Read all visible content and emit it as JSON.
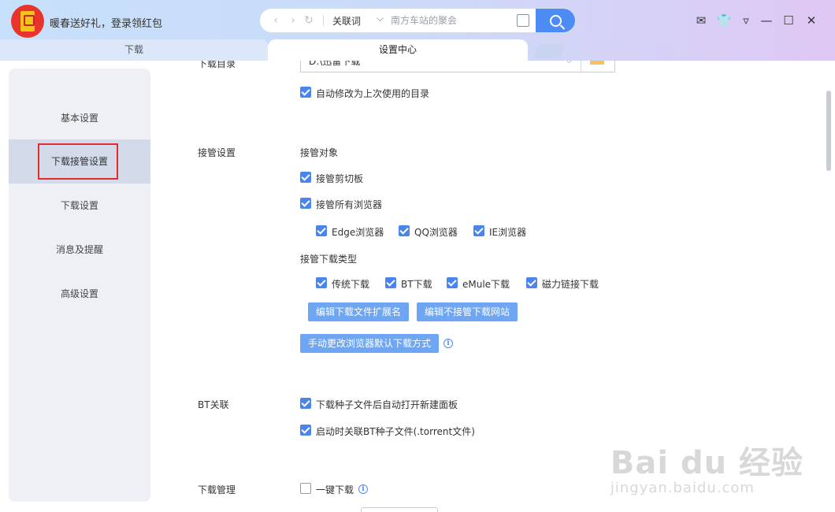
{
  "header": {
    "promo_text": "暖春送好礼，登录领红包",
    "search": {
      "keyword_label": "关联词",
      "placeholder": "南方车站的聚会"
    }
  },
  "tabs": [
    {
      "label": "下载"
    },
    {
      "label": "设置中心"
    }
  ],
  "sidebar": {
    "items": [
      {
        "label": "基本设置"
      },
      {
        "label": "下载接管设置"
      },
      {
        "label": "下载设置"
      },
      {
        "label": "消息及提醒"
      },
      {
        "label": "高级设置"
      }
    ],
    "active_index": 1
  },
  "basic": {
    "cut_label": "下载目录",
    "path_value": "D:\\迅雷下载",
    "auto_change_dir": "自动修改为上次使用的目录"
  },
  "takeover": {
    "section_label": "接管设置",
    "target_heading": "接管对象",
    "clipboard": "接管剪切板",
    "all_browsers": "接管所有浏览器",
    "browsers": [
      "Edge浏览器",
      "QQ浏览器",
      "IE浏览器"
    ],
    "type_heading": "接管下载类型",
    "types": [
      "传统下载",
      "BT下载",
      "eMule下载",
      "磁力链接下载"
    ],
    "btn_edit_ext": "编辑下载文件扩展名",
    "btn_edit_sites": "编辑不接管下载网站",
    "btn_manual_browser": "手动更改浏览器默认下载方式"
  },
  "bt": {
    "section_label": "BT关联",
    "auto_open_panel": "下载种子文件后自动打开新建面板",
    "assoc_torrent": "启动时关联BT种子文件(.torrent文件)"
  },
  "manage": {
    "section_label": "下载管理",
    "one_click": "一键下载"
  },
  "watermark": {
    "big": "Bai du 经验",
    "small": "jingyan.baidu.com"
  },
  "colors": {
    "accent": "#4e8cf5",
    "checkbox": "#4a85ee",
    "button": "#6ea6f3",
    "highlight_box": "#e22b2b"
  }
}
